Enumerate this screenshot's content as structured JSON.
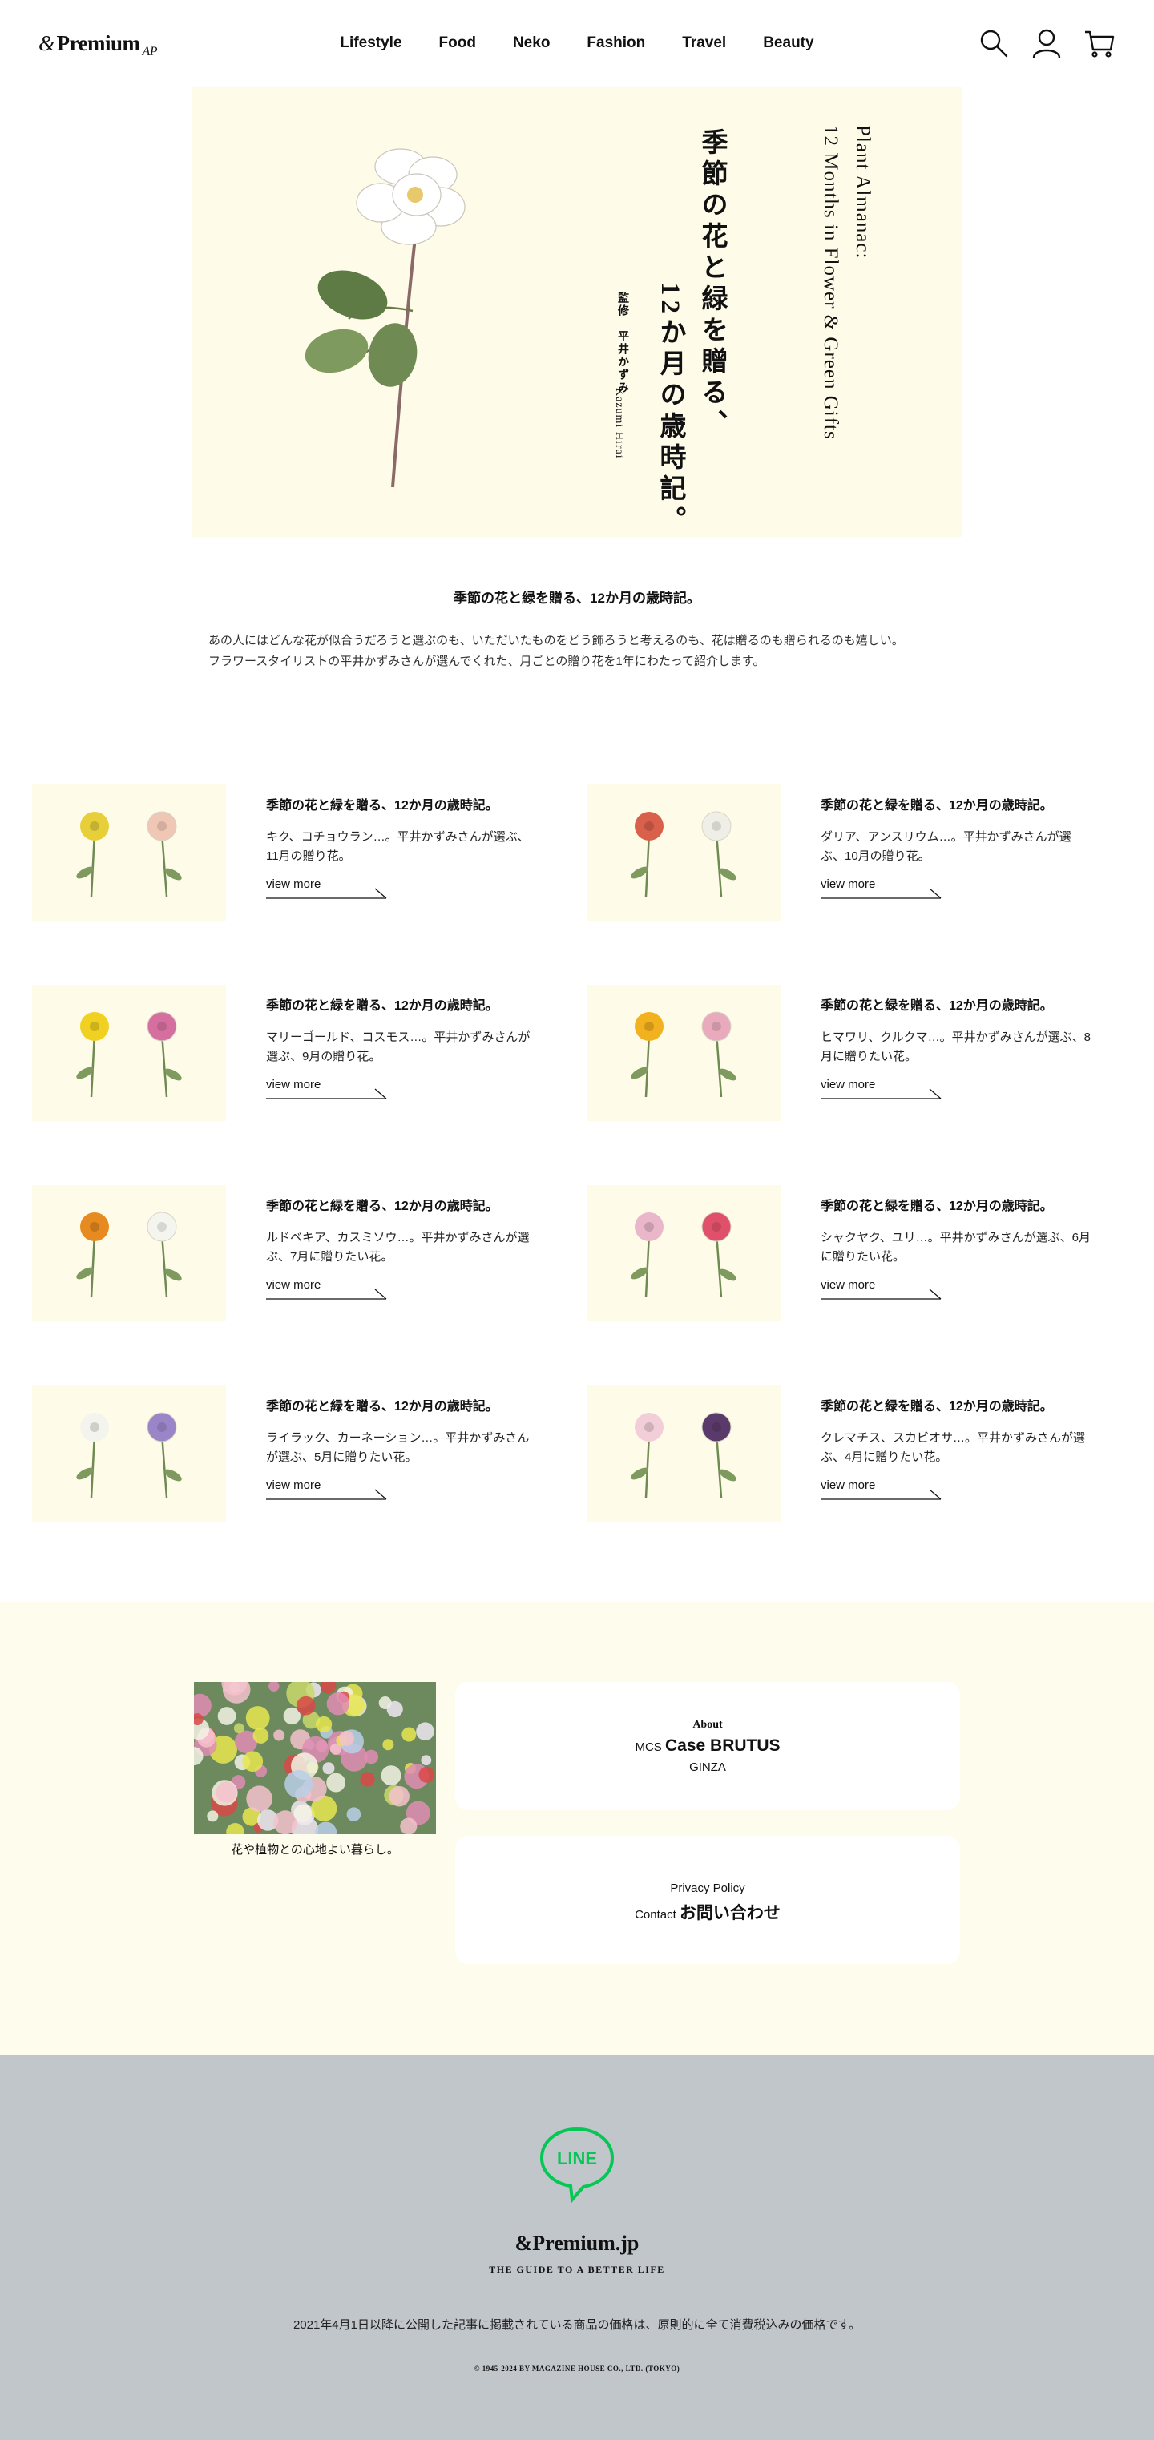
{
  "header": {
    "logo_amp": "&",
    "logo_text": "Premium",
    "logo_sig": "AP",
    "nav": [
      "Lifestyle",
      "Food",
      "Neko",
      "Fashion",
      "Travel",
      "Beauty"
    ]
  },
  "hero": {
    "title_en_1": "Plant Almanac:",
    "title_en_2": "12 Months in Flower & Green Gifts",
    "title_jp_1": "季節の花と緑を贈る、",
    "title_jp_2": "12か月の歳時記。",
    "supervisor": "監修　平井かずみ",
    "supervisor_en": "Kazumi Hirai"
  },
  "intro": {
    "title": "季節の花と緑を贈る、12か月の歳時記。",
    "desc_1": "あの人にはどんな花が似合うだろうと選ぶのも、いただいたものをどう飾ろうと考えるのも、花は贈るのも贈られるのも嬉しい。",
    "desc_2": "フラワースタイリストの平井かずみさんが選んでくれた、月ごとの贈り花を1年にわたって紹介します。"
  },
  "articles": [
    {
      "title": "季節の花と緑を贈る、12か月の歳時記。",
      "desc": "キク、コチョウラン…。平井かずみさんが選ぶ、11月の贈り花。",
      "link": "view more"
    },
    {
      "title": "季節の花と緑を贈る、12か月の歳時記。",
      "desc": "ダリア、アンスリウム…。平井かずみさんが選ぶ、10月の贈り花。",
      "link": "view more"
    },
    {
      "title": "季節の花と緑を贈る、12か月の歳時記。",
      "desc": "マリーゴールド、コスモス…。平井かずみさんが選ぶ、9月の贈り花。",
      "link": "view more"
    },
    {
      "title": "季節の花と緑を贈る、12か月の歳時記。",
      "desc": "ヒマワリ、クルクマ…。平井かずみさんが選ぶ、8月に贈りたい花。",
      "link": "view more"
    },
    {
      "title": "季節の花と緑を贈る、12か月の歳時記。",
      "desc": "ルドベキア、カスミソウ…。平井かずみさんが選ぶ、7月に贈りたい花。",
      "link": "view more"
    },
    {
      "title": "季節の花と緑を贈る、12か月の歳時記。",
      "desc": "シャクヤク、ユリ…。平井かずみさんが選ぶ、6月に贈りたい花。",
      "link": "view more"
    },
    {
      "title": "季節の花と緑を贈る、12か月の歳時記。",
      "desc": "ライラック、カーネーション…。平井かずみさんが選ぶ、5月に贈りたい花。",
      "link": "view more"
    },
    {
      "title": "季節の花と緑を贈る、12か月の歳時記。",
      "desc": "クレマチス、スカビオサ…。平井かずみさんが選ぶ、4月に贈りたい花。",
      "link": "view more"
    }
  ],
  "about": {
    "caption": "花や植物との心地よい暮らし。",
    "about_label": "About",
    "mcs": "MCS",
    "case_brutus": "Case BRUTUS",
    "ginza": "GINZA",
    "privacy": "Privacy Policy",
    "contact": "Contact",
    "contact_jp": "お問い合わせ"
  },
  "footer": {
    "line_label": "LINE",
    "logo": "&Premium.jp",
    "tagline": "THE GUIDE TO A BETTER LIFE",
    "note": "2021年4月1日以降に公開した記事に掲載されている商品の価格は、原則的に全て消費税込みの価格です。",
    "copyright": "© 1945-2024 BY MAGAZINE HOUSE CO., LTD. (TOKYO)"
  },
  "colors": {
    "cream": "#fefce9",
    "footer_gray": "#c1c6cb",
    "line_green": "#06c755"
  },
  "icons": [
    "search-icon",
    "user-icon",
    "cart-icon",
    "arrow-right-icon",
    "line-icon"
  ]
}
